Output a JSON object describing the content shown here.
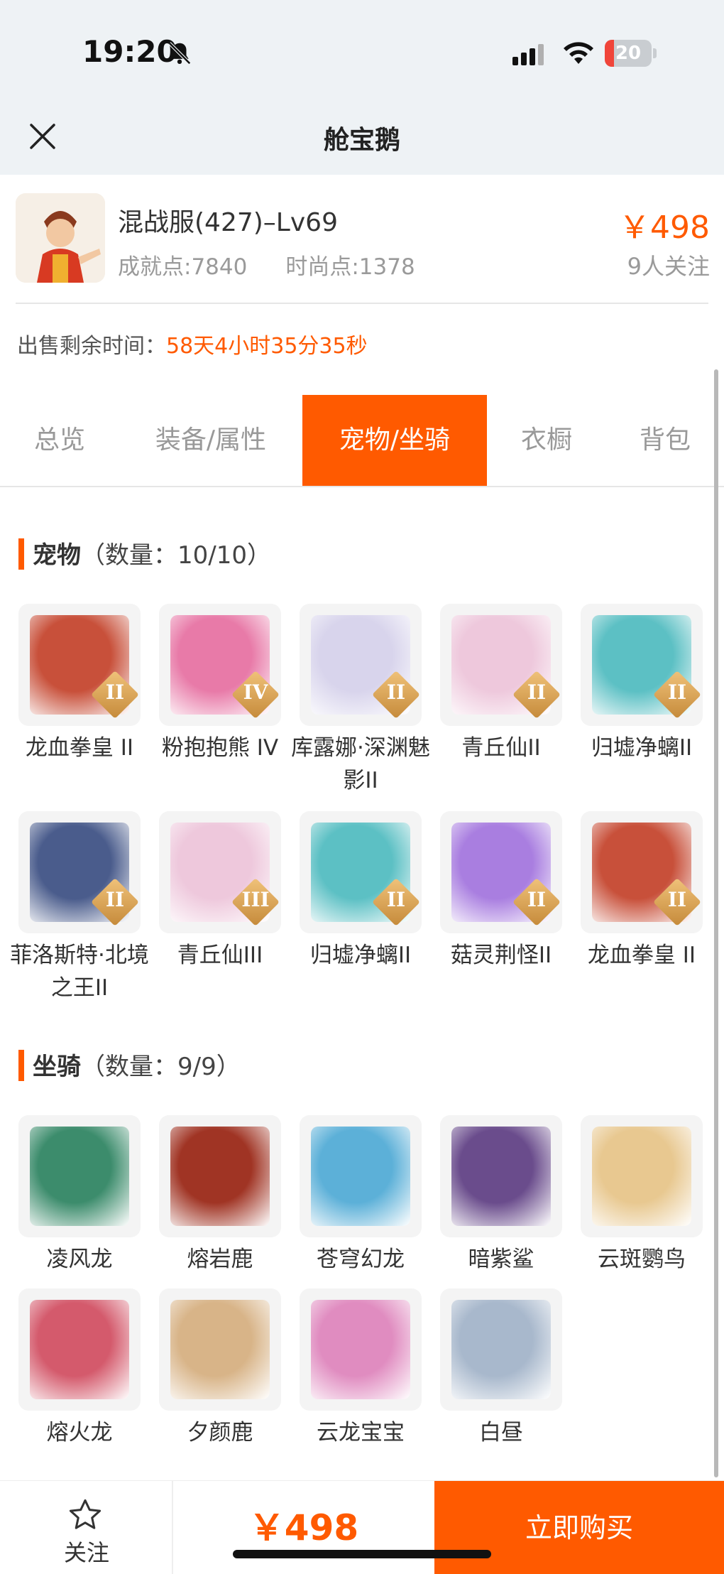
{
  "status_bar": {
    "time": "19:20",
    "battery": "20",
    "battery_fraction": 0.2,
    "icons": [
      "bell-slash-icon",
      "signal-icon",
      "wifi-icon",
      "battery-icon"
    ]
  },
  "header": {
    "title": "舱宝鹅",
    "close_icon": "close-icon"
  },
  "product": {
    "name": "混战服(427)–Lv69",
    "achievement": "成就点:7840",
    "fashion": "时尚点:1378",
    "price": "￥498",
    "followers": "9人关注"
  },
  "remaining": {
    "label": "出售剩余时间：",
    "value": "58天4小时35分35秒"
  },
  "tabs": [
    {
      "label": "总览",
      "active": false
    },
    {
      "label": "装备/属性",
      "active": false
    },
    {
      "label": "宠物/坐骑",
      "active": true
    },
    {
      "label": "衣橱",
      "active": false
    },
    {
      "label": "背包",
      "active": false
    }
  ],
  "pets": {
    "title": "宠物",
    "count": "（数量：10/10）",
    "items": [
      {
        "name": "龙血拳皇 II",
        "badge": "II",
        "color": "#c8503a"
      },
      {
        "name": "粉抱抱熊 IV",
        "badge": "IV",
        "color": "#e87aa8"
      },
      {
        "name": "库露娜·深渊魅影II",
        "badge": "II",
        "color": "#d8d4ec"
      },
      {
        "name": "青丘仙II",
        "badge": "II",
        "color": "#eec8dc"
      },
      {
        "name": "归墟净螭II",
        "badge": "II",
        "color": "#5cc0c4"
      },
      {
        "name": "菲洛斯特·北境之王II",
        "badge": "II",
        "color": "#4a5c8c"
      },
      {
        "name": "青丘仙III",
        "badge": "III",
        "color": "#eec8dc"
      },
      {
        "name": "归墟净螭II",
        "badge": "II",
        "color": "#5cc0c4"
      },
      {
        "name": "菇灵荆怪II",
        "badge": "II",
        "color": "#a97ee0"
      },
      {
        "name": "龙血拳皇 II",
        "badge": "II",
        "color": "#c8503a"
      }
    ]
  },
  "mounts": {
    "title": "坐骑",
    "count": "（数量：9/9）",
    "items": [
      {
        "name": "凌风龙",
        "color": "#3c8c6c"
      },
      {
        "name": "熔岩鹿",
        "color": "#a03424"
      },
      {
        "name": "苍穹幻龙",
        "color": "#5cb0d8"
      },
      {
        "name": "暗紫鲨",
        "color": "#6a4c8c"
      },
      {
        "name": "云斑鹦鸟",
        "color": "#e8c890"
      },
      {
        "name": "熔火龙",
        "color": "#d45a6c"
      },
      {
        "name": "夕颜鹿",
        "color": "#d8b488"
      },
      {
        "name": "云龙宝宝",
        "color": "#e08cc0"
      },
      {
        "name": "白昼",
        "color": "#a8b8cc"
      }
    ]
  },
  "bottom": {
    "follow_label": "关注",
    "price": "￥498",
    "buy_label": "立即购买"
  },
  "colors": {
    "accent": "#ff5a00",
    "header_bg": "#eef2f5"
  }
}
